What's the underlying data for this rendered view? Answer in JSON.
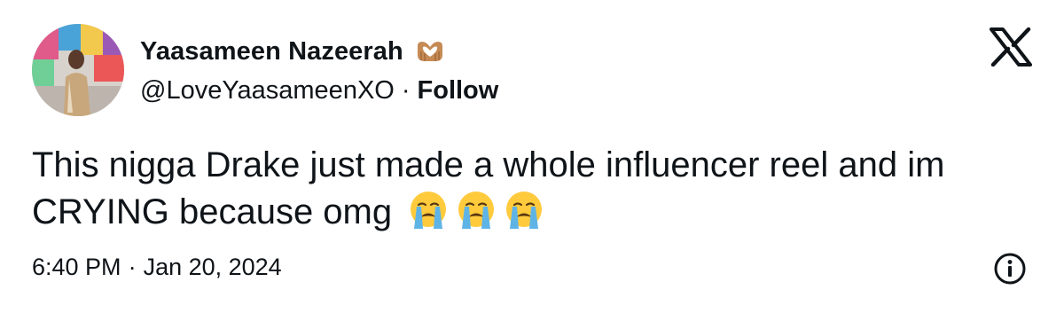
{
  "tweet": {
    "author": {
      "display_name": "Yaasameen Nazeerah",
      "handle": "@LoveYaasameenXO",
      "badge_icon": "heart-hands-icon",
      "avatar_icon": "avatar"
    },
    "follow_separator": "·",
    "follow_label": "Follow",
    "platform_icon": "x-logo-icon",
    "text": "This nigga Drake just made a whole influencer reel and im CRYING because omg",
    "emojis": [
      "crying-emoji-icon",
      "crying-emoji-icon",
      "crying-emoji-icon"
    ],
    "time": "6:40 PM",
    "date_separator": "·",
    "date": "Jan 20, 2024",
    "info_icon": "info-icon"
  },
  "colors": {
    "text": "#0f1419",
    "background": "#ffffff",
    "emoji_face": "#ffcb3d",
    "emoji_tears": "#5fb4e6",
    "heart_hands": "#c68a55"
  }
}
